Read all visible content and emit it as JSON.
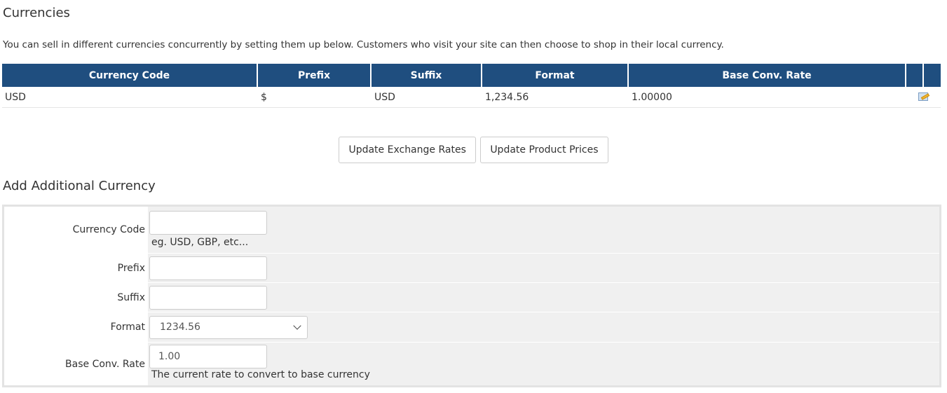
{
  "page": {
    "title": "Currencies",
    "intro": "You can sell in different currencies concurrently by setting them up below. Customers who visit your site can then choose to shop in their local currency."
  },
  "table": {
    "headers": [
      "Currency Code",
      "Prefix",
      "Suffix",
      "Format",
      "Base Conv. Rate",
      "",
      ""
    ],
    "rows": [
      {
        "code": "USD",
        "prefix": "$",
        "suffix": "USD",
        "format": "1,234.56",
        "rate": "1.00000",
        "action_icon": "edit-icon"
      }
    ]
  },
  "buttons": {
    "update_rates": "Update Exchange Rates",
    "update_prices": "Update Product Prices"
  },
  "add_form": {
    "title": "Add Additional Currency",
    "currency_code": {
      "label": "Currency Code",
      "value": "",
      "hint": "eg. USD, GBP, etc..."
    },
    "prefix": {
      "label": "Prefix",
      "value": ""
    },
    "suffix": {
      "label": "Suffix",
      "value": ""
    },
    "format": {
      "label": "Format",
      "selected": "1234.56"
    },
    "base_rate": {
      "label": "Base Conv. Rate",
      "value": "1.00",
      "hint": "The current rate to convert to base currency"
    }
  },
  "colors": {
    "header_bg": "#1f4e7f",
    "form_bg": "#f0f0f0"
  }
}
